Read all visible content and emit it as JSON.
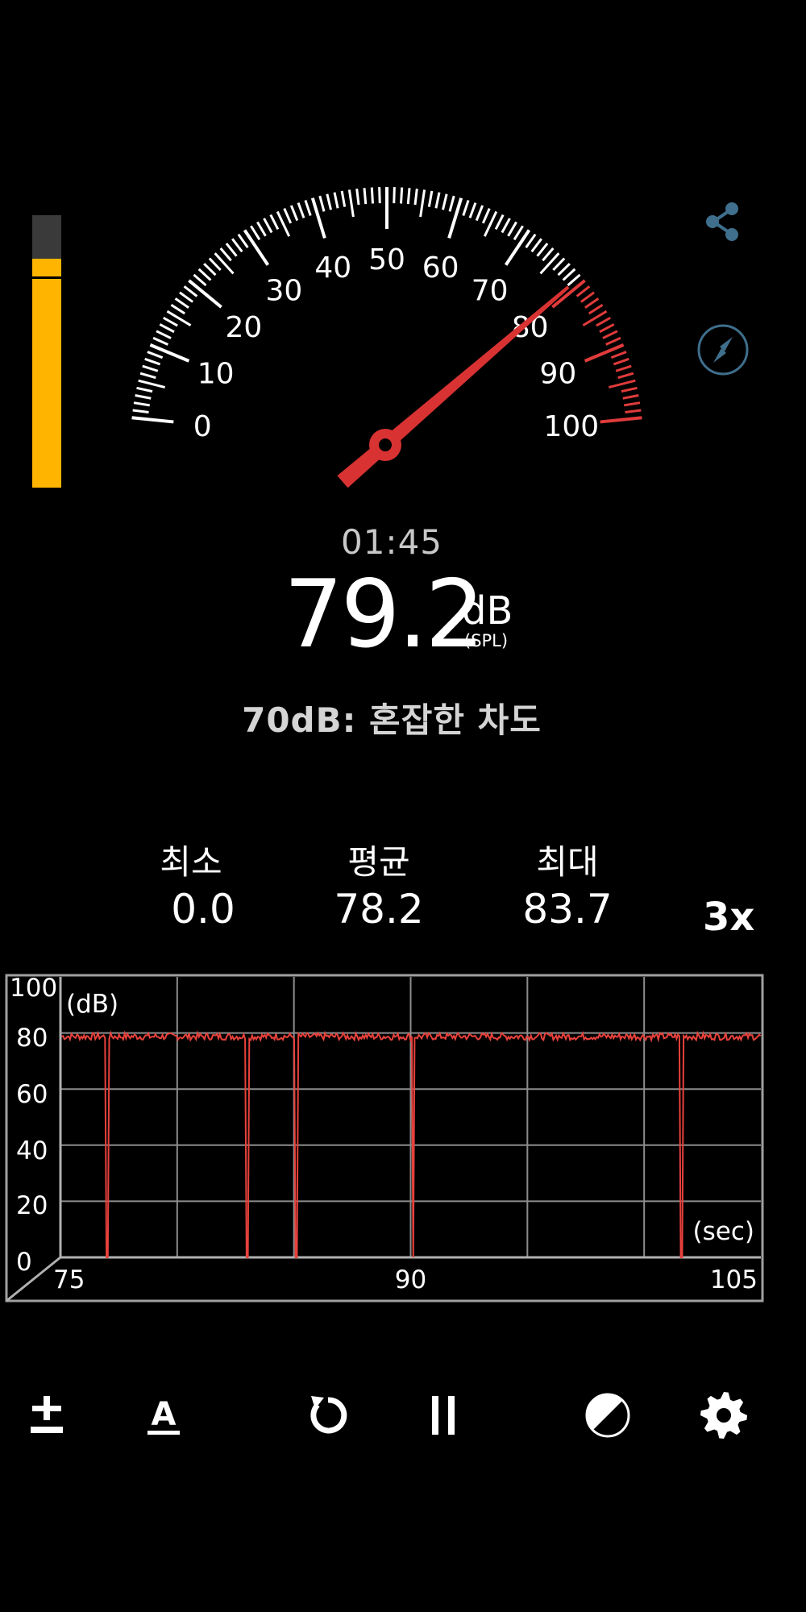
{
  "level": {
    "fraction": 0.84,
    "peak_fraction": 0.765
  },
  "gauge": {
    "min": 0,
    "max": 100,
    "value": 79.2,
    "red_zone_start": 80,
    "tick_labels": [
      "0",
      "10",
      "20",
      "30",
      "40",
      "50",
      "60",
      "70",
      "80",
      "90",
      "100"
    ],
    "colors": {
      "white": "#ffffff",
      "red": "#e03b3b",
      "needle": "#d93232"
    }
  },
  "icons": {
    "share": "share-icon",
    "compass": "compass-icon"
  },
  "display": {
    "timer": "01:45",
    "reading": "79.2",
    "unit": "dB",
    "unit_sub": "(SPL)",
    "reference": "70dB: 혼잡한 차도"
  },
  "stats": {
    "min_label": "최소",
    "min_value": "0.0",
    "avg_label": "평균",
    "avg_value": "78.2",
    "max_label": "최대",
    "max_value": "83.7"
  },
  "speed_label": "3x",
  "chart_data": {
    "type": "line",
    "ylabel": "(dB)",
    "xlabel": "(sec)",
    "xlim": [
      75,
      105
    ],
    "ylim": [
      0,
      100
    ],
    "ytick_labels": [
      "100",
      "80",
      "60",
      "40",
      "20",
      "0"
    ],
    "xtick_labels": [
      "75",
      "90",
      "105"
    ],
    "grid": true,
    "baseline_db": 79,
    "dropouts_sec": [
      77.0,
      83.0,
      85.1,
      90.1,
      101.6
    ],
    "line_color": "#e8413c"
  },
  "toolbar": {
    "calibrate": "calibrate-icon",
    "weighting": "a-weighting-icon",
    "reset": "reset-icon",
    "pause": "pause-icon",
    "theme": "contrast-icon",
    "settings": "gear-icon"
  }
}
